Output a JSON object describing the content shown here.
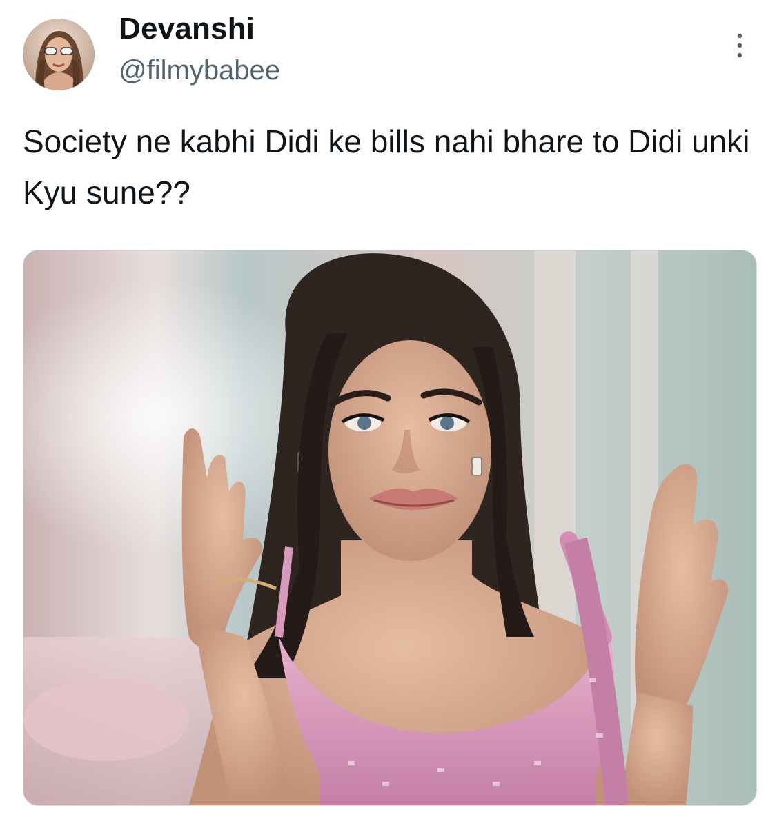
{
  "tweet": {
    "author": {
      "display_name": "Devanshi",
      "handle": "@filmybabee",
      "avatar_icon": "user-avatar"
    },
    "more_icon": "more-vertical-icon",
    "text": "Society ne kabhi Didi ke bills nahi bhare to Didi unki Kyu sune??",
    "media": {
      "type": "photo",
      "accent_colors": [
        "#f1c4d8",
        "#c98aa8",
        "#2e2420",
        "#d9b59c"
      ]
    }
  },
  "colors": {
    "text_primary": "#0f1419",
    "text_secondary": "#536471",
    "background": "#ffffff"
  }
}
